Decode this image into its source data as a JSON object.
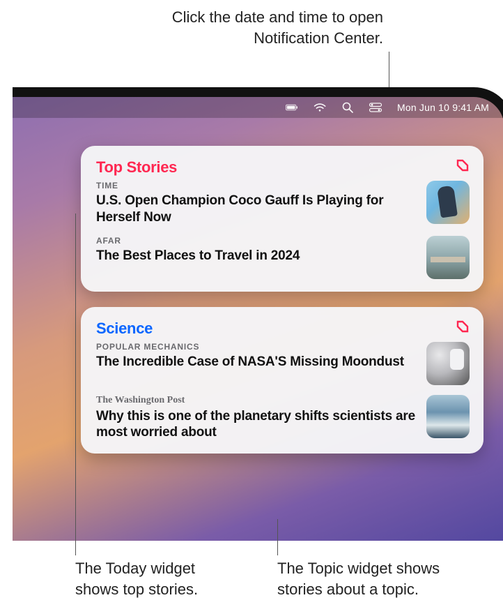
{
  "callouts": {
    "top": "Click the date and time to open Notification Center.",
    "bottom_left": "The Today widget shows top stories.",
    "bottom_right": "The Topic widget shows stories about a topic."
  },
  "menubar": {
    "datetime": "Mon Jun 10  9:41 AM"
  },
  "widgets": [
    {
      "title": "Top Stories",
      "title_color": "red",
      "stories": [
        {
          "source": "TIME",
          "headline": "U.S. Open Champion Coco Gauff Is Playing for Herself Now"
        },
        {
          "source": "AFAR",
          "headline": "The Best Places to Travel in 2024"
        }
      ]
    },
    {
      "title": "Science",
      "title_color": "blue",
      "stories": [
        {
          "source": "POPULAR MECHANICS",
          "headline": "The Incredible Case of NASA'S Missing Moondust"
        },
        {
          "source": "The Washington Post",
          "source_serif": true,
          "headline": "Why this is one of the planetary shifts scientists are most worried about"
        }
      ]
    }
  ]
}
